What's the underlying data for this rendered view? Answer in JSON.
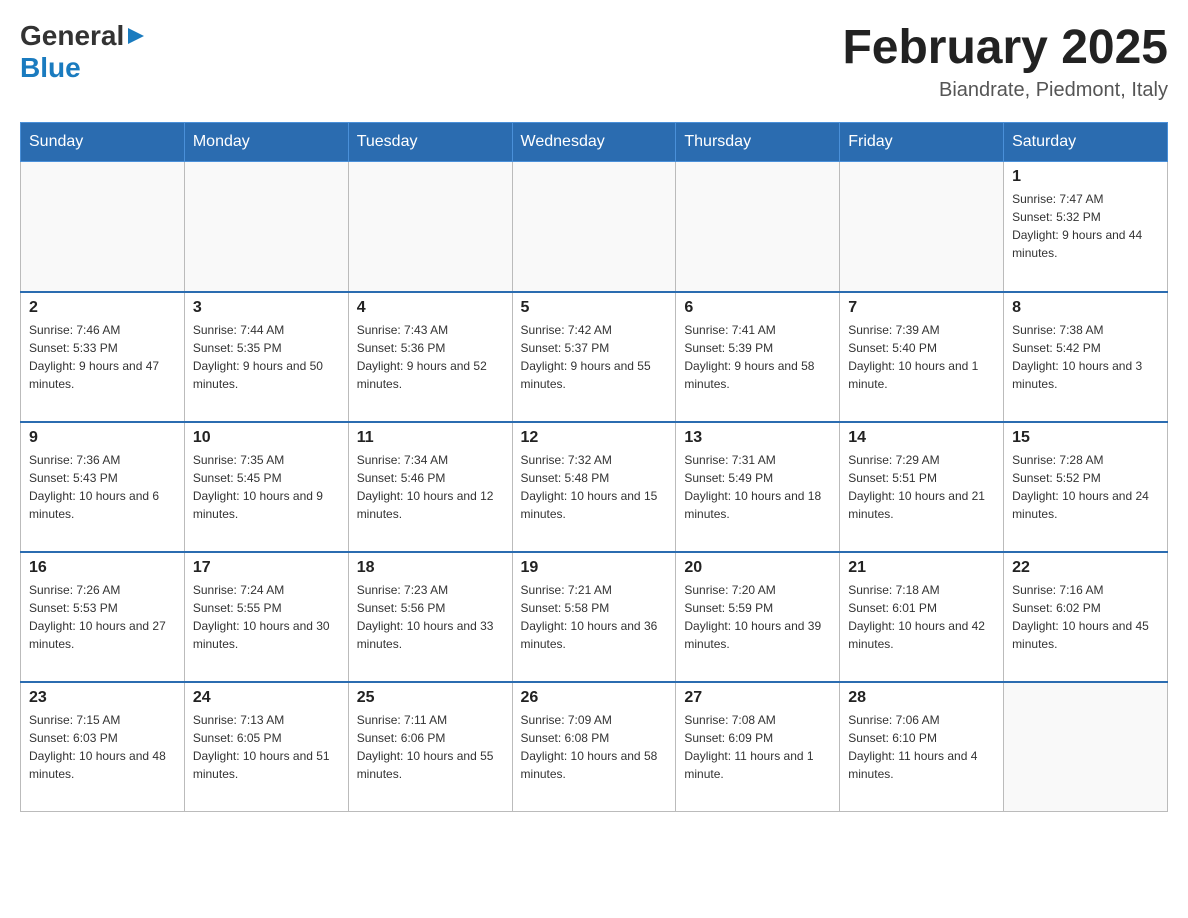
{
  "header": {
    "logo_general": "General",
    "logo_blue": "Blue",
    "month_title": "February 2025",
    "location": "Biandrate, Piedmont, Italy"
  },
  "days_of_week": [
    "Sunday",
    "Monday",
    "Tuesday",
    "Wednesday",
    "Thursday",
    "Friday",
    "Saturday"
  ],
  "weeks": [
    [
      {
        "day": "",
        "info": ""
      },
      {
        "day": "",
        "info": ""
      },
      {
        "day": "",
        "info": ""
      },
      {
        "day": "",
        "info": ""
      },
      {
        "day": "",
        "info": ""
      },
      {
        "day": "",
        "info": ""
      },
      {
        "day": "1",
        "info": "Sunrise: 7:47 AM\nSunset: 5:32 PM\nDaylight: 9 hours and 44 minutes."
      }
    ],
    [
      {
        "day": "2",
        "info": "Sunrise: 7:46 AM\nSunset: 5:33 PM\nDaylight: 9 hours and 47 minutes."
      },
      {
        "day": "3",
        "info": "Sunrise: 7:44 AM\nSunset: 5:35 PM\nDaylight: 9 hours and 50 minutes."
      },
      {
        "day": "4",
        "info": "Sunrise: 7:43 AM\nSunset: 5:36 PM\nDaylight: 9 hours and 52 minutes."
      },
      {
        "day": "5",
        "info": "Sunrise: 7:42 AM\nSunset: 5:37 PM\nDaylight: 9 hours and 55 minutes."
      },
      {
        "day": "6",
        "info": "Sunrise: 7:41 AM\nSunset: 5:39 PM\nDaylight: 9 hours and 58 minutes."
      },
      {
        "day": "7",
        "info": "Sunrise: 7:39 AM\nSunset: 5:40 PM\nDaylight: 10 hours and 1 minute."
      },
      {
        "day": "8",
        "info": "Sunrise: 7:38 AM\nSunset: 5:42 PM\nDaylight: 10 hours and 3 minutes."
      }
    ],
    [
      {
        "day": "9",
        "info": "Sunrise: 7:36 AM\nSunset: 5:43 PM\nDaylight: 10 hours and 6 minutes."
      },
      {
        "day": "10",
        "info": "Sunrise: 7:35 AM\nSunset: 5:45 PM\nDaylight: 10 hours and 9 minutes."
      },
      {
        "day": "11",
        "info": "Sunrise: 7:34 AM\nSunset: 5:46 PM\nDaylight: 10 hours and 12 minutes."
      },
      {
        "day": "12",
        "info": "Sunrise: 7:32 AM\nSunset: 5:48 PM\nDaylight: 10 hours and 15 minutes."
      },
      {
        "day": "13",
        "info": "Sunrise: 7:31 AM\nSunset: 5:49 PM\nDaylight: 10 hours and 18 minutes."
      },
      {
        "day": "14",
        "info": "Sunrise: 7:29 AM\nSunset: 5:51 PM\nDaylight: 10 hours and 21 minutes."
      },
      {
        "day": "15",
        "info": "Sunrise: 7:28 AM\nSunset: 5:52 PM\nDaylight: 10 hours and 24 minutes."
      }
    ],
    [
      {
        "day": "16",
        "info": "Sunrise: 7:26 AM\nSunset: 5:53 PM\nDaylight: 10 hours and 27 minutes."
      },
      {
        "day": "17",
        "info": "Sunrise: 7:24 AM\nSunset: 5:55 PM\nDaylight: 10 hours and 30 minutes."
      },
      {
        "day": "18",
        "info": "Sunrise: 7:23 AM\nSunset: 5:56 PM\nDaylight: 10 hours and 33 minutes."
      },
      {
        "day": "19",
        "info": "Sunrise: 7:21 AM\nSunset: 5:58 PM\nDaylight: 10 hours and 36 minutes."
      },
      {
        "day": "20",
        "info": "Sunrise: 7:20 AM\nSunset: 5:59 PM\nDaylight: 10 hours and 39 minutes."
      },
      {
        "day": "21",
        "info": "Sunrise: 7:18 AM\nSunset: 6:01 PM\nDaylight: 10 hours and 42 minutes."
      },
      {
        "day": "22",
        "info": "Sunrise: 7:16 AM\nSunset: 6:02 PM\nDaylight: 10 hours and 45 minutes."
      }
    ],
    [
      {
        "day": "23",
        "info": "Sunrise: 7:15 AM\nSunset: 6:03 PM\nDaylight: 10 hours and 48 minutes."
      },
      {
        "day": "24",
        "info": "Sunrise: 7:13 AM\nSunset: 6:05 PM\nDaylight: 10 hours and 51 minutes."
      },
      {
        "day": "25",
        "info": "Sunrise: 7:11 AM\nSunset: 6:06 PM\nDaylight: 10 hours and 55 minutes."
      },
      {
        "day": "26",
        "info": "Sunrise: 7:09 AM\nSunset: 6:08 PM\nDaylight: 10 hours and 58 minutes."
      },
      {
        "day": "27",
        "info": "Sunrise: 7:08 AM\nSunset: 6:09 PM\nDaylight: 11 hours and 1 minute."
      },
      {
        "day": "28",
        "info": "Sunrise: 7:06 AM\nSunset: 6:10 PM\nDaylight: 11 hours and 4 minutes."
      },
      {
        "day": "",
        "info": ""
      }
    ]
  ]
}
